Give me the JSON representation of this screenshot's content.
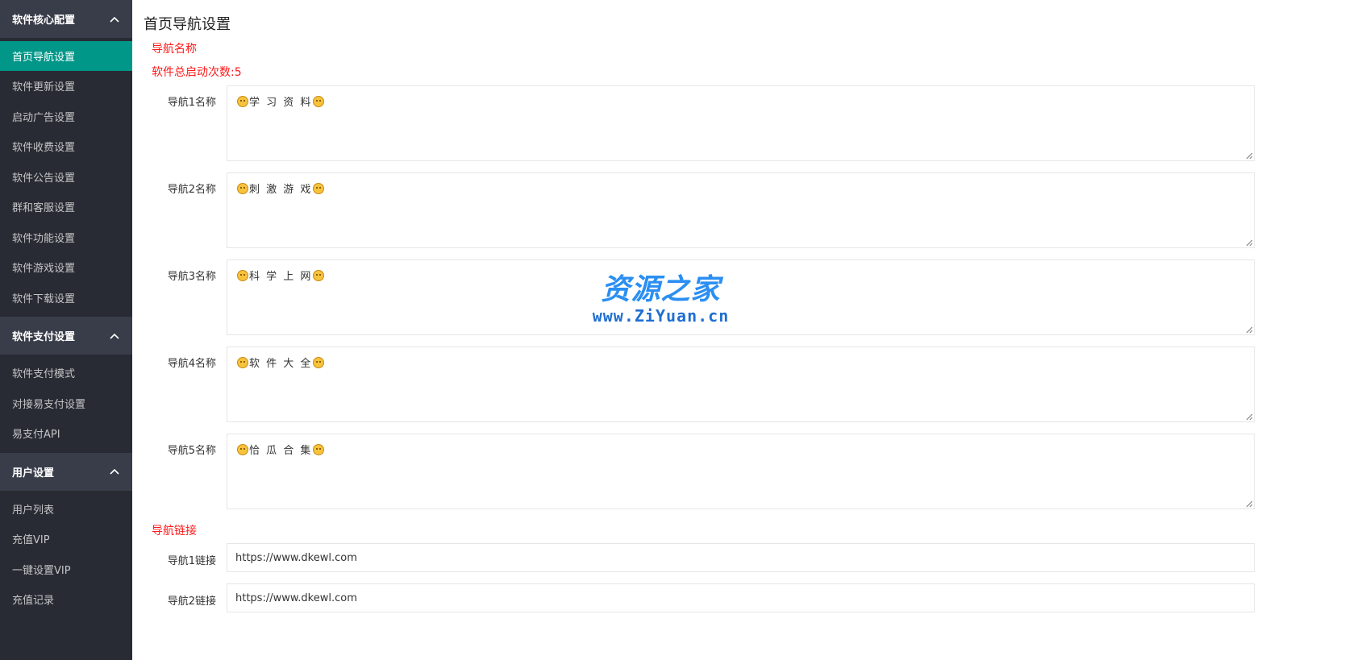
{
  "sidebar": {
    "groups": [
      {
        "title": "软件核心配置",
        "items": [
          "首页导航设置",
          "软件更新设置",
          "启动广告设置",
          "软件收费设置",
          "软件公告设置",
          "群和客服设置",
          "软件功能设置",
          "软件游戏设置",
          "软件下载设置"
        ]
      },
      {
        "title": "软件支付设置",
        "items": [
          "软件支付模式",
          "对接易支付设置",
          "易支付API"
        ]
      },
      {
        "title": "用户设置",
        "items": [
          "用户列表",
          "充值VIP",
          "一键设置VIP",
          "充值记录"
        ]
      }
    ],
    "active_item": "首页导航设置"
  },
  "main": {
    "title": "首页导航设置",
    "nav_name_section": "导航名称",
    "launch_count": "软件总启动次数:5",
    "nav_names": [
      {
        "label": "导航1名称",
        "value": "学 习 资 料"
      },
      {
        "label": "导航2名称",
        "value": "刺 激 游 戏"
      },
      {
        "label": "导航3名称",
        "value": "科 学 上 网"
      },
      {
        "label": "导航4名称",
        "value": "软 件 大 全"
      },
      {
        "label": "导航5名称",
        "value": "恰 瓜 合 集"
      }
    ],
    "nav_link_section": "导航链接",
    "nav_links": [
      {
        "label": "导航1链接",
        "value": "https://www.dkewl.com"
      },
      {
        "label": "导航2链接",
        "value": "https://www.dkewl.com"
      }
    ]
  },
  "watermark": {
    "title": "资源之家",
    "url": "www.ZiYuan.cn"
  },
  "colors": {
    "sidebar_bg": "#282b33",
    "group_header_bg": "#393d49",
    "active_bg": "#009688",
    "section_red": "#ff1a1a",
    "watermark_blue": "#2b8ff2"
  }
}
